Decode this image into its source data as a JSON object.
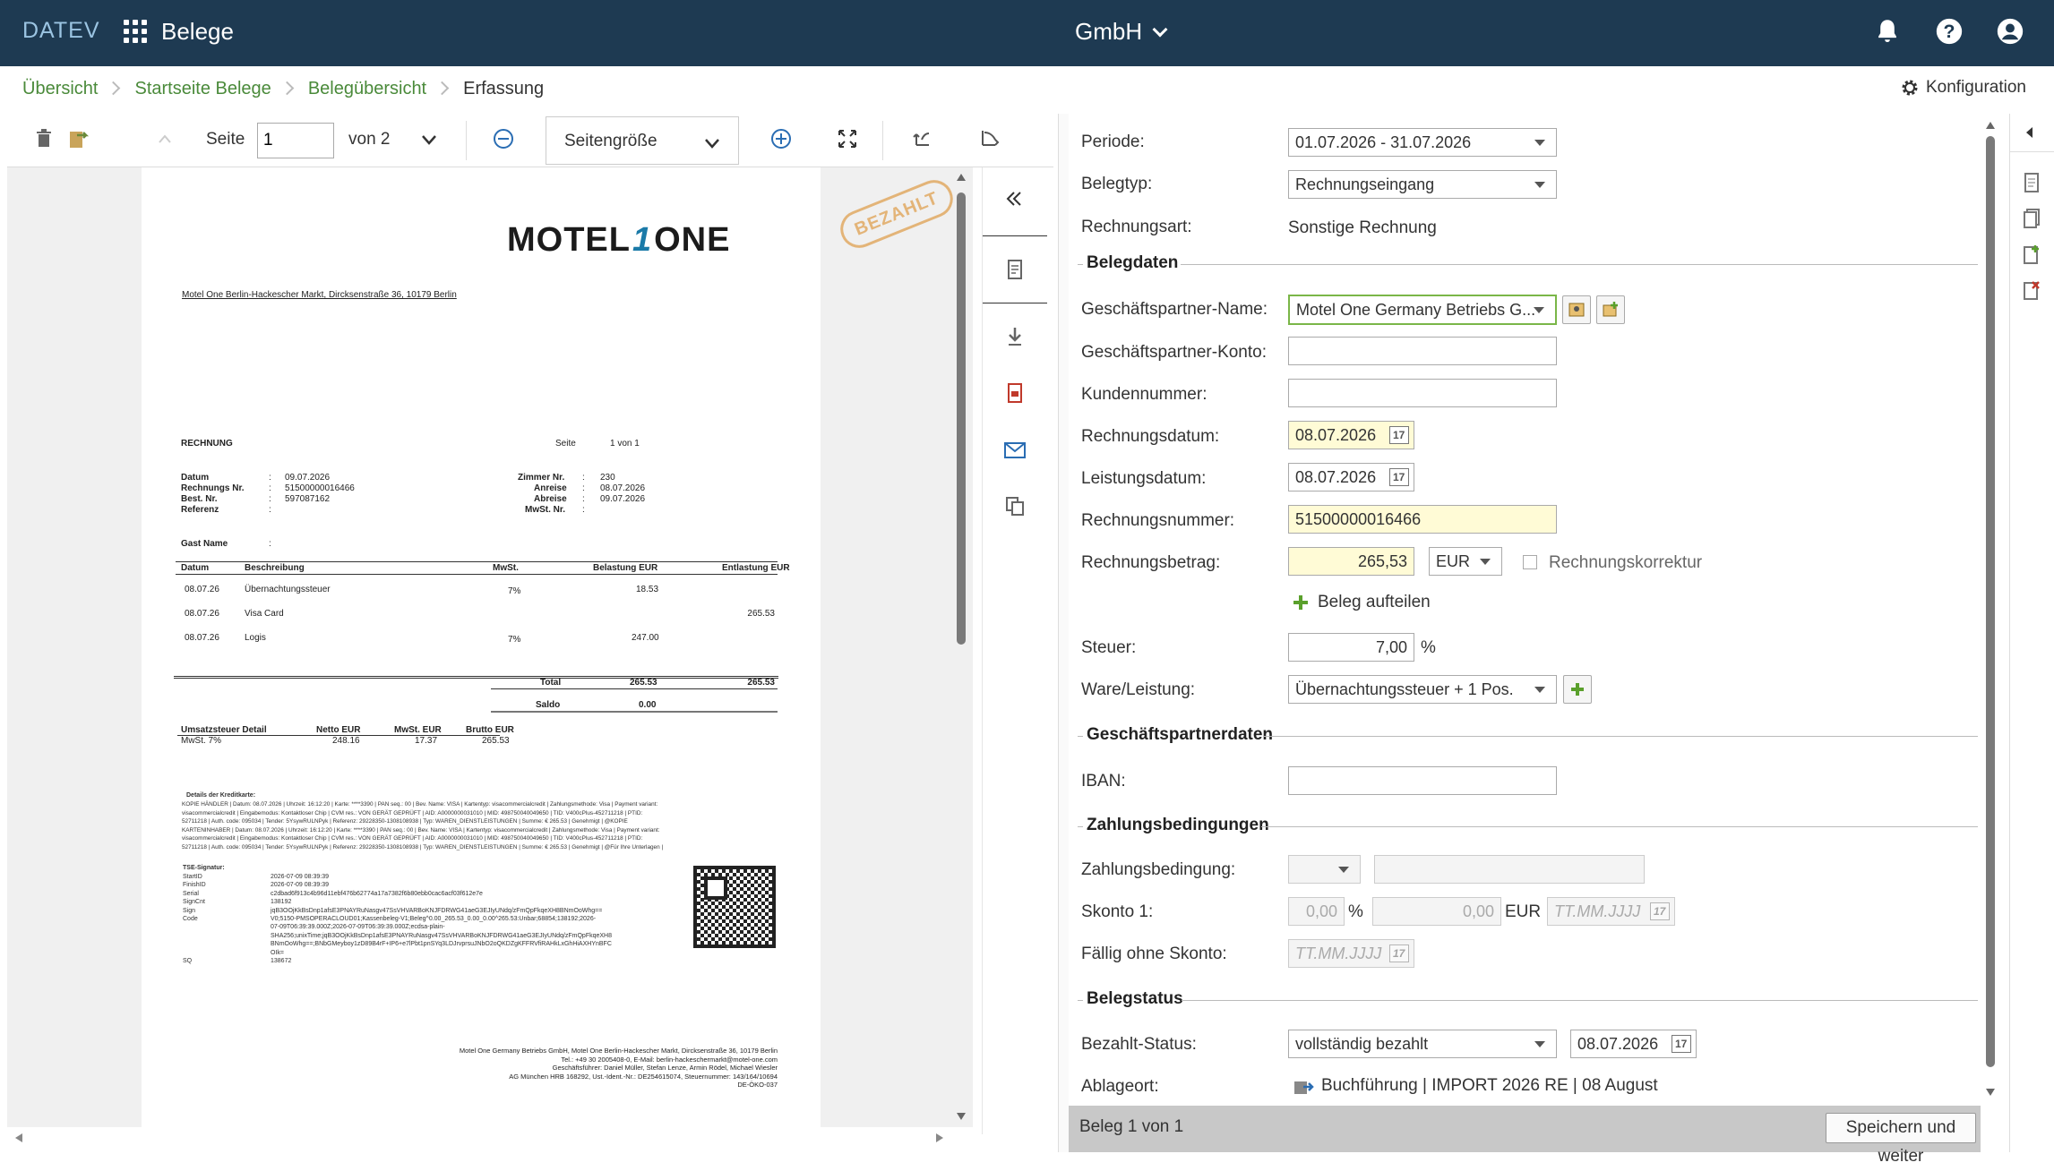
{
  "topbar": {
    "brand": "DATEV",
    "app_title": "Belege",
    "company": "GmbH"
  },
  "breadcrumb": [
    {
      "label": "Übersicht"
    },
    {
      "label": "Startseite Belege"
    },
    {
      "label": "Belegübersicht"
    },
    {
      "label": "Erfassung"
    }
  ],
  "konfig_label": "Konfiguration",
  "toolbar": {
    "page_label": "Seite",
    "page_value": "1",
    "of_label": "von 2",
    "zoom_value": "Seitengröße"
  },
  "document": {
    "stamp": "BEZAHLT",
    "logo_left": "MOTEL",
    "logo_mid": "1",
    "logo_right": "ONE",
    "sender_line": "Motel One Berlin-Hackescher Markt, Dircksenstraße 36, 10179 Berlin",
    "title": "RECHNUNG",
    "seite_label": "Seite",
    "seite_value": "1 von 1",
    "datum_label": "Datum",
    "datum_value": "09.07.2026",
    "rechnungsnr_label": "Rechnungs Nr.",
    "rechnungsnr_value": "51500000016466",
    "bestnr_label": "Best. Nr.",
    "bestnr_value": "597087162",
    "referenz_label": "Referenz",
    "zimmer_label": "Zimmer Nr.",
    "zimmer_value": "230",
    "anreise_label": "Anreise",
    "anreise_value": "08.07.2026",
    "abreise_label": "Abreise",
    "abreise_value": "09.07.2026",
    "mwstnr_label": "MwSt. Nr.",
    "gast_label": "Gast Name",
    "table_headers": [
      "Datum",
      "Beschreibung",
      "MwSt.",
      "Belastung EUR",
      "Entlastung EUR"
    ],
    "rows": [
      {
        "datum": "08.07.26",
        "desc": "Übernachtungssteuer",
        "mwst": "7%",
        "bel": "18.53",
        "ent": ""
      },
      {
        "datum": "08.07.26",
        "desc": "Visa Card",
        "mwst": "",
        "bel": "",
        "ent": "265.53"
      },
      {
        "datum": "08.07.26",
        "desc": "Logis",
        "mwst": "7%",
        "bel": "247.00",
        "ent": ""
      }
    ],
    "total_label": "Total",
    "total_bel": "265.53",
    "total_ent": "265.53",
    "saldo_label": "Saldo",
    "saldo_value": "0.00",
    "ust_headers": [
      "Umsatzsteuer Detail",
      "Netto EUR",
      "MwSt. EUR",
      "Brutto EUR"
    ],
    "ust_row": [
      "MwSt. 7%",
      "248.16",
      "17.37",
      "265.53"
    ],
    "kk_title": "Details der Kreditkarte:",
    "kk_lines": [
      "KOPIE HÄNDLER | Datum: 08.07.2026 | Uhrzeit: 16:12:20 | Karte: ****3390 | PAN seq.: 00 | Bev. Name: VISA | Kartentyp: visacommercialcredit | Zahlungsmethode: Visa | Payment variant:",
      "visacommercialcredit | Eingabemodus: Kontaktloser Chip | CVM res.: VON GERÄT GEPRÜFT | AID: A0000000031010 | MID: 498750040049650 | TID: V400cPlus-452711218 | PTID:",
      "52711218 | Auth. code: 095034 | Tender: 5YsywRULNPyk | Referenz: 29228350-1308108938 | Typ: WAREN_DIENSTLEISTUNGEN | Summe: € 265.53 | Genehmigt | @KOPIE",
      "KARTENINHABER | Datum: 08.07.2026 | Uhrzeit: 16:12:20 | Karte: ****3390 | PAN seq.: 00 | Bev. Name: VISA | Kartentyp: visacommercialcredit | Zahlungsmethode: Visa | Payment variant:",
      "visacommercialcredit | Eingabemodus: Kontaktloser Chip | CVM res.: VON GERÄT GEPRÜFT | AID: A0000000031010 | MID: 498750040049650 | TID: V400cPlus-452711218 | PTID:",
      "52711218 | Auth. code: 095034 | Tender: 5YsywRULNPyk | Referenz: 29228350-1308108938 | Typ: WAREN_DIENSTLEISTUNGEN | Summe: € 265.53 | Genehmigt | @Für Ihre Unterlagen |"
    ],
    "tse_title": "TSE-Signatur:",
    "tse_lines": [
      [
        "StartID",
        "2026-07-09 08:39:39"
      ],
      [
        "FinishID",
        "2026-07-09 08:39:39"
      ],
      [
        "Serial",
        "c2dbad6f913c4b96d11ebf476b62774a17a7382f6b80ebb0cac6acf03f612e7e"
      ],
      [
        "SignCnt",
        "138192"
      ],
      [
        "Sign",
        "jqB3OOjKkBsDnp1afsE3PNAYRuNasgv47SsVHVARBoKNJFDRWG41aeG3EJIyUNdq/zFmQpFkqeXH8BNmOoWhg=="
      ],
      [
        "Code",
        "V0;5150-PMSOPERACLOUD01;Kassenbeleg-V1;Beleg^0.00_265.53_0.00_0.00^265.53:Unbar;68854;138192;2026-"
      ],
      [
        "",
        "07-09T06:39:39.000Z;2026-07-09T06:39:39.000Z;ecdsa-plain-"
      ],
      [
        "",
        "SHA256;unixTime;jqB3OOjKkBsDnp1afsE3PNAYRuNasgv47SsVHVARBoKNJFDRWG41aeG3EJIyUNdq/zFmQpFkqeXH8"
      ],
      [
        "",
        "BNmOoWhg==;BNbGMeyboy1zD89B4rF+IP6+e7lPbt1pnSYq3LDJrvprsuJNbO2oQKDZgKFFRVfiRAHkLxGhHiAXHYnBFC"
      ],
      [
        "",
        "OIk="
      ],
      [
        "SQ",
        "138672"
      ]
    ],
    "footer_lines": [
      "Motel One Germany Betriebs GmbH, Motel One Berlin-Hackescher Markt, Dircksenstraße 36, 10179 Berlin",
      "Tel.: +49 30 2005408-0, E-Mail: berlin-hackeschermarkt@motel-one.com",
      "Geschäftsführer: Daniel Müller, Stefan Lenze, Armin Rödel, Michael Wiesler",
      "AG München HRB 168292, Ust.-Ident.-Nr.: DE254615074, Steuernummer: 143/164/10694",
      "DE-ÖKO-037"
    ]
  },
  "form": {
    "periode_label": "Periode:",
    "periode_value": "01.07.2026 - 31.07.2026",
    "belegtyp_label": "Belegtyp:",
    "belegtyp_value": "Rechnungseingang",
    "rechnungsart_label": "Rechnungsart:",
    "rechnungsart_value": "Sonstige Rechnung",
    "sec_belegdaten": "Belegdaten",
    "gp_name_label": "Geschäftspartner-Name:",
    "gp_name_value": "Motel One Germany Betriebs G...",
    "gp_konto_label": "Geschäftspartner-Konto:",
    "gp_konto_value": "",
    "kundennr_label": "Kundennummer:",
    "kundennr_value": "",
    "rdatum_label": "Rechnungsdatum:",
    "rdatum_value": "08.07.2026",
    "ldatum_label": "Leistungsdatum:",
    "ldatum_value": "08.07.2026",
    "rnr_label": "Rechnungsnummer:",
    "rnr_value": "51500000016466",
    "rbetrag_label": "Rechnungsbetrag:",
    "rbetrag_value": "265,53",
    "currency": "EUR",
    "korrektur_label": "Rechnungskorrektur",
    "aufteilen_label": "Beleg aufteilen",
    "steuer_label": "Steuer:",
    "steuer_value": "7,00",
    "steuer_unit": "%",
    "ware_label": "Ware/Leistung:",
    "ware_value": "Übernachtungssteuer + 1 Pos.",
    "sec_gp": "Geschäftspartnerdaten",
    "iban_label": "IBAN:",
    "iban_value": "",
    "sec_zahlung": "Zahlungsbedingungen",
    "zb_label": "Zahlungsbedingung:",
    "skonto_label": "Skonto 1:",
    "skonto_pct": "0,00",
    "skonto_pct_unit": "%",
    "skonto_amt": "0,00",
    "skonto_cur": "EUR",
    "skonto_date_ph": "TT.MM.JJJJ",
    "faellig_label": "Fällig ohne Skonto:",
    "faellig_ph": "TT.MM.JJJJ",
    "sec_status": "Belegstatus",
    "bezahlt_label": "Bezahlt-Status:",
    "bezahlt_value": "vollständig bezahlt",
    "bezahlt_date": "08.07.2026",
    "ablage_label": "Ablageort:",
    "ablage_value": "Buchführung | IMPORT 2026 RE | 08 August"
  },
  "bottom": {
    "count": "Beleg 1 von 1",
    "save": "Speichern und weiter"
  }
}
